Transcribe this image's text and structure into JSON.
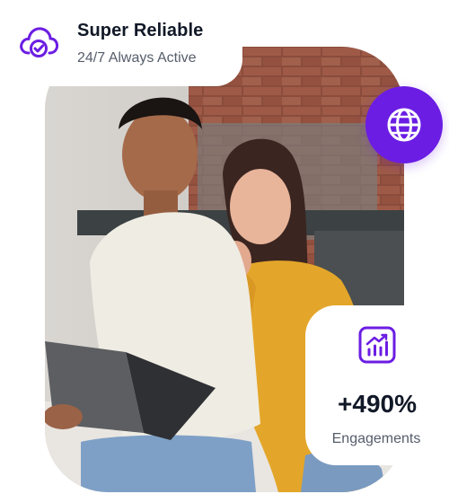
{
  "reliability_badge": {
    "icon": "cloud-check-icon",
    "title": "Super Reliable",
    "subtitle": "24/7 Always Active"
  },
  "globe_button": {
    "icon": "globe-icon"
  },
  "engagement_card": {
    "icon": "chart-growth-icon",
    "value": "+490%",
    "label": "Engagements"
  },
  "hero_photo": {
    "icon": "hero-photo"
  },
  "colors": {
    "accent": "#6b1de3",
    "text_dark": "#111827",
    "text_muted": "#555d6b",
    "card_bg": "#ffffff"
  }
}
